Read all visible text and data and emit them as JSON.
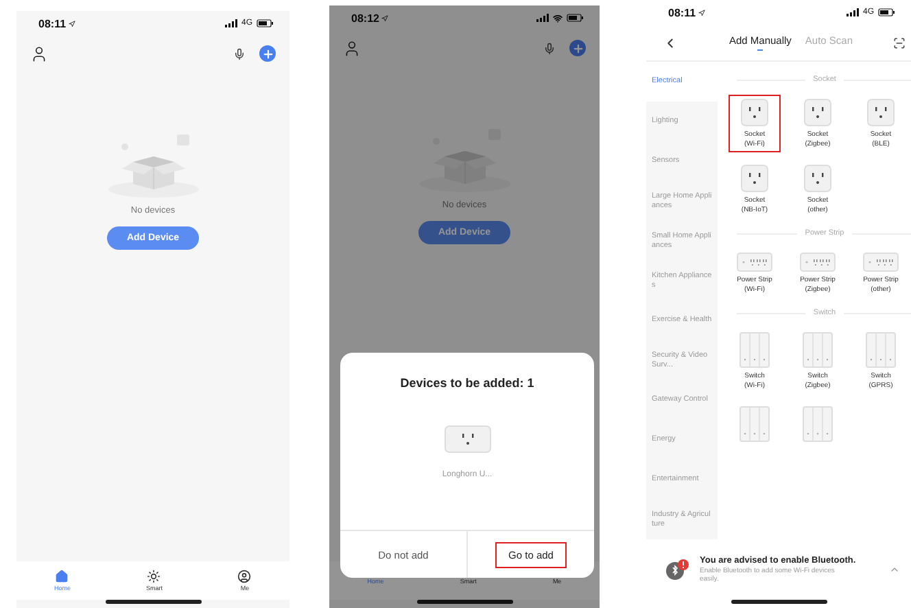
{
  "home_screen": {
    "status_bar": {
      "time": "08:11",
      "network": "4G"
    },
    "empty_state": {
      "message": "No devices"
    },
    "add_button": "Add Device",
    "tab_bar": [
      {
        "label": "Home",
        "selected": true
      },
      {
        "label": "Smart",
        "selected": false
      },
      {
        "label": "Me",
        "selected": false
      }
    ]
  },
  "home_screen_with_dialog": {
    "status_bar": {
      "time": "08:12"
    },
    "empty_state": {
      "message": "No devices"
    },
    "add_button": "Add Device",
    "tab_bar": [
      {
        "label": "Home",
        "selected": true
      },
      {
        "label": "Smart",
        "selected": false
      },
      {
        "label": "Me",
        "selected": false
      }
    ],
    "dialog": {
      "title": "Devices to be added: 1",
      "device_name": "Longhorn U...",
      "buttons": [
        {
          "label": "Do not add",
          "highlighted": false
        },
        {
          "label": "Go to add",
          "highlighted": true
        }
      ]
    }
  },
  "add_device_screen": {
    "status_bar": {
      "time": "08:11",
      "network": "4G"
    },
    "tabs": [
      {
        "label": "Add Manually",
        "selected": true
      },
      {
        "label": "Auto Scan",
        "selected": false
      }
    ],
    "categories": [
      {
        "label": "Electrical",
        "selected": true
      },
      {
        "label": "Lighting",
        "selected": false
      },
      {
        "label": "Sensors",
        "selected": false
      },
      {
        "label": "Large Home Appliances",
        "selected": false
      },
      {
        "label": "Small Home Appliances",
        "selected": false
      },
      {
        "label": "Kitchen Appliances",
        "selected": false
      },
      {
        "label": "Exercise & Health",
        "selected": false
      },
      {
        "label": "Security & Video Surv...",
        "selected": false
      },
      {
        "label": "Gateway Control",
        "selected": false
      },
      {
        "label": "Energy",
        "selected": false
      },
      {
        "label": "Entertainment",
        "selected": false
      },
      {
        "label": "Industry & Agriculture",
        "selected": false
      }
    ],
    "sections": [
      {
        "title": "Socket",
        "devices": [
          {
            "kind": "socket",
            "name": "Socket",
            "variant": "(Wi-Fi)",
            "highlighted": true
          },
          {
            "kind": "socket",
            "name": "Socket",
            "variant": "(Zigbee)",
            "highlighted": false
          },
          {
            "kind": "socket",
            "name": "Socket",
            "variant": "(BLE)",
            "highlighted": false
          },
          {
            "kind": "socket",
            "name": "Socket",
            "variant": "(NB-IoT)",
            "highlighted": false
          },
          {
            "kind": "socket",
            "name": "Socket",
            "variant": "(other)",
            "highlighted": false
          }
        ]
      },
      {
        "title": "Power Strip",
        "devices": [
          {
            "kind": "power_strip",
            "name": "Power Strip",
            "variant": "(Wi-Fi)",
            "highlighted": false
          },
          {
            "kind": "power_strip",
            "name": "Power Strip",
            "variant": "(Zigbee)",
            "highlighted": false
          },
          {
            "kind": "power_strip",
            "name": "Power Strip",
            "variant": "(other)",
            "highlighted": false
          }
        ]
      },
      {
        "title": "Switch",
        "devices": [
          {
            "kind": "switch",
            "name": "Switch",
            "variant": "(Wi-Fi)",
            "highlighted": false
          },
          {
            "kind": "switch",
            "name": "Switch",
            "variant": "(Zigbee)",
            "highlighted": false
          },
          {
            "kind": "switch",
            "name": "Switch",
            "variant": "(GPRS)",
            "highlighted": false
          },
          {
            "kind": "switch",
            "highlighted": false
          },
          {
            "kind": "switch",
            "highlighted": false
          }
        ]
      }
    ],
    "notice": {
      "title": "You are advised to enable Bluetooth.",
      "body": "Enable Bluetooth to add some Wi-Fi devices easily."
    }
  }
}
